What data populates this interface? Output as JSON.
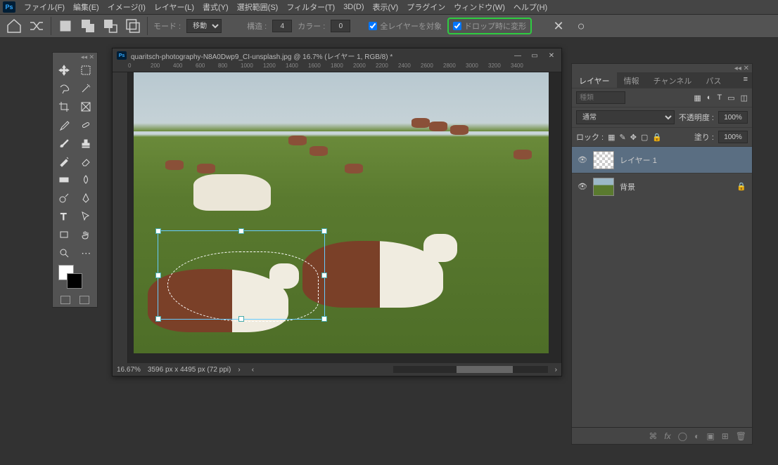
{
  "menubar": {
    "items": [
      "ファイル(F)",
      "編集(E)",
      "イメージ(I)",
      "レイヤー(L)",
      "書式(Y)",
      "選択範囲(S)",
      "フィルター(T)",
      "3D(D)",
      "表示(V)",
      "プラグイン",
      "ウィンドウ(W)",
      "ヘルプ(H)"
    ]
  },
  "optionsbar": {
    "mode_label": "モード :",
    "mode_value": "移動",
    "struct_label": "構造 :",
    "struct_value": "4",
    "color_label": "カラー :",
    "color_value": "0",
    "check_all_layers": "全レイヤーを対象",
    "check_transform": "ドロップ時に変形"
  },
  "document": {
    "title": "quaritsch-photography-N8A0Dwp9_CI-unsplash.jpg @ 16.7% (レイヤー 1, RGB/8) *",
    "ruler_marks": [
      "0",
      "200",
      "400",
      "600",
      "800",
      "1000",
      "1200",
      "1400",
      "1600",
      "1800",
      "2000",
      "2200",
      "2400",
      "2600",
      "2800",
      "3000",
      "3200",
      "3400"
    ],
    "zoom": "16.67%",
    "dimensions": "3596 px x 4495 px (72 ppi)"
  },
  "panels": {
    "tabs": [
      "レイヤー",
      "情報",
      "チャンネル",
      "パス"
    ],
    "search_placeholder": "種類",
    "blend_mode": "通常",
    "opacity_label": "不透明度 :",
    "opacity_value": "100%",
    "lock_label": "ロック :",
    "fill_label": "塗り :",
    "fill_value": "100%",
    "layers": [
      {
        "name": "レイヤー 1",
        "visible": true,
        "active": true,
        "locked": false,
        "checker": true
      },
      {
        "name": "背景",
        "visible": true,
        "active": false,
        "locked": true,
        "checker": false
      }
    ]
  }
}
